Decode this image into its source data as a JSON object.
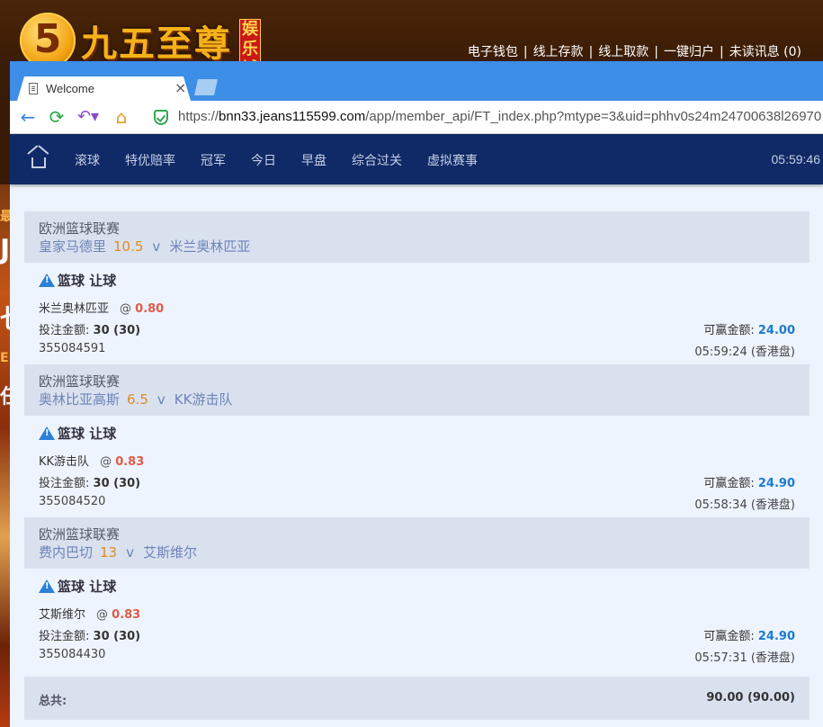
{
  "background_site": {
    "logo_digit": "5",
    "logo_text": "九五至尊",
    "logo_tag": "娱乐城",
    "top_links": [
      "电子钱包",
      "线上存款",
      "线上取款",
      "一键归户",
      "未读讯息 (0)"
    ],
    "left_strip_chars": [
      "最",
      "J",
      "乜",
      "E",
      "任"
    ]
  },
  "browser": {
    "tab_title": "Welcome",
    "url_scheme": "https://",
    "url_host": "bnn33.jeans115599.com",
    "url_path": "/app/member_api/FT_index.php?mtype=3&uid=phhv0s24m24700638l26970"
  },
  "nav": {
    "items": [
      "滚球",
      "特优赔率",
      "冠军",
      "今日",
      "早盘",
      "综合过关",
      "虚拟赛事"
    ],
    "clock": "05:59:46"
  },
  "bets": [
    {
      "league": "欧洲篮球联赛",
      "home": "皇家马德里",
      "handicap": "10.5",
      "vs": "v",
      "away": "米兰奥林匹亚",
      "bet_type": "篮球 让球",
      "pick": "米兰奥林匹亚",
      "at": "@",
      "odds": "0.80",
      "stake_label": "投注金额:",
      "stake": "30 (30)",
      "win_label": "可赢金额:",
      "win": "24.00",
      "ticket": "355084591",
      "time": "05:59:24 (香港盘)"
    },
    {
      "league": "欧洲篮球联赛",
      "home": "奥林比亚高斯",
      "handicap": "6.5",
      "vs": "v",
      "away": "KK游击队",
      "bet_type": "篮球 让球",
      "pick": "KK游击队",
      "at": "@",
      "odds": "0.83",
      "stake_label": "投注金额:",
      "stake": "30 (30)",
      "win_label": "可赢金额:",
      "win": "24.90",
      "ticket": "355084520",
      "time": "05:58:34 (香港盘)"
    },
    {
      "league": "欧洲篮球联赛",
      "home": "费内巴切",
      "handicap": "13",
      "vs": "v",
      "away": "艾斯维尔",
      "bet_type": "篮球 让球",
      "pick": "艾斯维尔",
      "at": "@",
      "odds": "0.83",
      "stake_label": "投注金额:",
      "stake": "30 (30)",
      "win_label": "可赢金额:",
      "win": "24.90",
      "ticket": "355084430",
      "time": "05:57:31 (香港盘)"
    }
  ],
  "total": {
    "label": "总共:",
    "value": "90.00 (90.00)"
  },
  "colors": {
    "nav_bg": "#0f2a66",
    "tabstrip": "#3c8ee6",
    "handicap": "#e08a20",
    "odds": "#e05a4a",
    "win_amount": "#1a7ad2"
  },
  "icons": [
    "home-icon",
    "back-arrow-icon",
    "refresh-icon",
    "undo-icon",
    "browser-home-icon",
    "secure-shield-icon",
    "warning-icon",
    "document-icon",
    "close-icon"
  ]
}
